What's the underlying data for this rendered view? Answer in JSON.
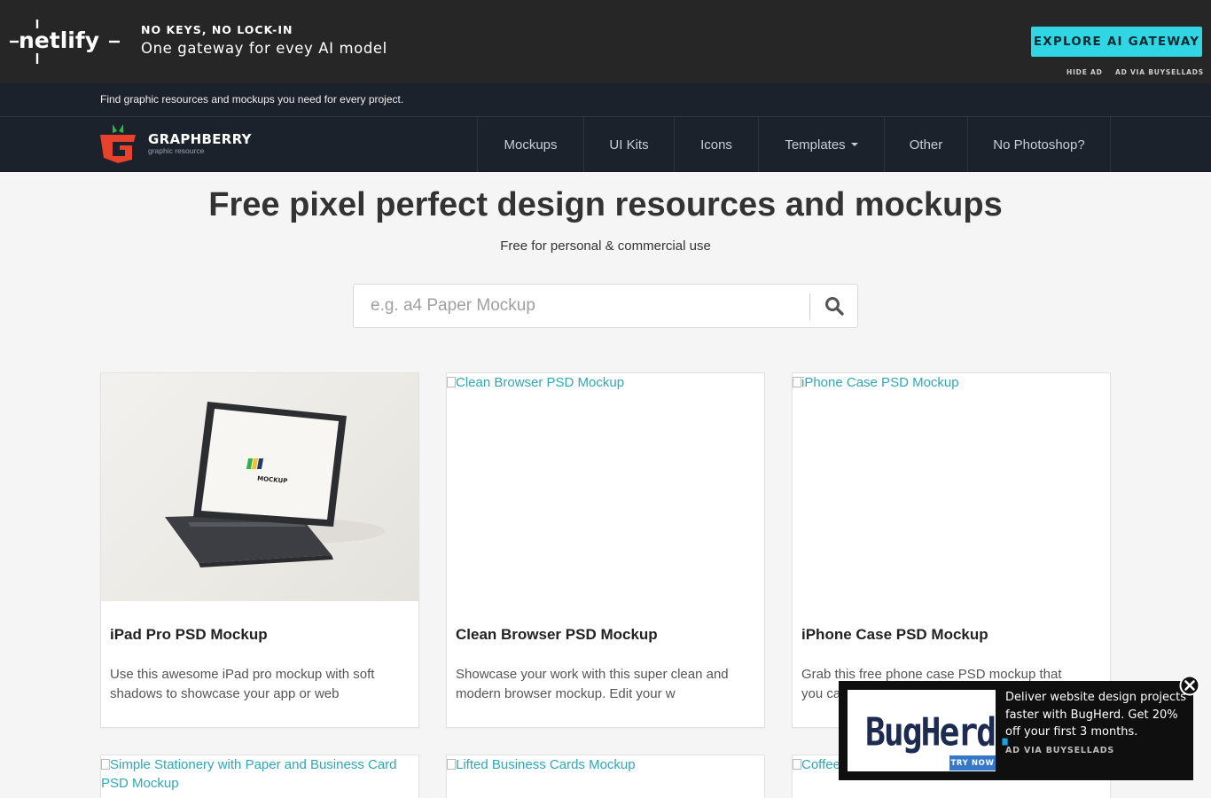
{
  "ad": {
    "brand": "netlify",
    "kicker": "NO KEYS, NO LOCK-IN",
    "tagline": "One gateway for evey AI model",
    "cta": "EXPLORE AI GATEWAY",
    "hide_ad": "HIDE AD",
    "via": "AD VIA BUYSELLADS"
  },
  "site": {
    "tagline": "Find graphic resources and mockups you need for every project.",
    "brand_name": "GRAPHBERRY",
    "brand_sub": "graphic resource",
    "nav": [
      {
        "label": "Mockups",
        "has_caret": false
      },
      {
        "label": "UI Kits",
        "has_caret": false
      },
      {
        "label": "Icons",
        "has_caret": false
      },
      {
        "label": "Templates",
        "has_caret": true
      },
      {
        "label": "Other",
        "has_caret": false
      },
      {
        "label": "No Photoshop?",
        "has_caret": false
      }
    ]
  },
  "hero": {
    "title": "Free pixel perfect design resources and mockups",
    "subtitle": "Free for personal & commercial use",
    "search_placeholder": "e.g. a4 Paper Mockup"
  },
  "cards": [
    {
      "title": "iPad Pro PSD Mockup",
      "description": "Use this awesome iPad pro mockup with soft shadows to showcase your app or web",
      "image_alt": "",
      "image_loaded": true,
      "screen_text": "MOCKUP"
    },
    {
      "title": "Clean Browser PSD Mockup",
      "description": "Showcase your work with this super clean and modern browser mockup. Edit your w",
      "image_alt": "Clean Browser PSD Mockup",
      "image_loaded": false
    },
    {
      "title": "iPhone Case PSD Mockup",
      "description": "Grab this free phone case PSD mockup that you can us",
      "image_alt": "iPhone Case PSD Mockup",
      "image_loaded": false
    },
    {
      "image_alt": "Simple Stationery with Paper and Business Card PSD Mockup",
      "image_loaded": false
    },
    {
      "image_alt": "Lifted Business Cards Mockup",
      "image_loaded": false
    },
    {
      "image_alt": "Coffee",
      "image_loaded": false
    }
  ],
  "popup_ad": {
    "logo": "BugHerd",
    "logo_dot": ".",
    "badge": "TRY NOW",
    "copy": "Deliver website design projects faster with BugHerd. Get 20% off your first 3 months.",
    "via": "AD VIA BUYSELLADS"
  },
  "colors": {
    "accent": "#31d6e4",
    "nav_bg": "#1c222c",
    "ad_bg": "#262626",
    "link": "#2ea8b7",
    "brand_red": "#e8412c",
    "brand_green": "#2db34a"
  }
}
